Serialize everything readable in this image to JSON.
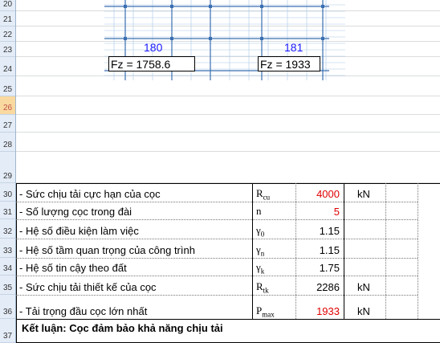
{
  "row_headers": [
    "20",
    "21",
    "22",
    "23",
    "24",
    "25",
    "26",
    "27",
    "28",
    "29",
    "30",
    "31",
    "32",
    "33",
    "34",
    "35",
    "36",
    "37"
  ],
  "active_row": "26",
  "diagram": {
    "pile_left": {
      "number": "180",
      "fz": "Fz = 1758.6"
    },
    "pile_right": {
      "number": "181",
      "fz": "Fz = 1933"
    }
  },
  "table": {
    "rows": [
      {
        "desc": "- Sức chịu tải cực hạn của cọc",
        "sym": "R",
        "sub": "cu",
        "value": "4000",
        "value_red": true,
        "unit": "kN"
      },
      {
        "desc": "- Số lượng cọc trong đài",
        "sym": "n",
        "sub": "",
        "value": "5",
        "value_red": true,
        "unit": ""
      },
      {
        "desc": "- Hệ số điều kiện làm việc",
        "sym": "γ",
        "sub": "0",
        "value": "1.15",
        "value_red": false,
        "unit": ""
      },
      {
        "desc": "- Hệ số tầm quan trọng của công trình",
        "sym": "γ",
        "sub": "n",
        "value": "1.15",
        "value_red": false,
        "unit": ""
      },
      {
        "desc": "- Hệ số tin cậy theo đất",
        "sym": "γ",
        "sub": "k",
        "value": "1.75",
        "value_red": false,
        "unit": ""
      },
      {
        "desc": "- Sức chịu tải thiết kế của cọc",
        "sym": "R",
        "sub": "tk",
        "value": "2286",
        "value_red": false,
        "unit": "kN"
      },
      {
        "desc": "- Tải trọng đầu cọc lớn nhất",
        "sym": "P",
        "sub": "max",
        "value": "1933",
        "value_red": true,
        "unit": "kN"
      }
    ],
    "conclusion": "Kết luận: Cọc đảm bảo khả năng chịu tải"
  },
  "colors": {
    "red": "#e00000",
    "blue": "#1a1aff",
    "header_bg": "#e4ecf7",
    "active_row_bg": "#f9d99f"
  }
}
